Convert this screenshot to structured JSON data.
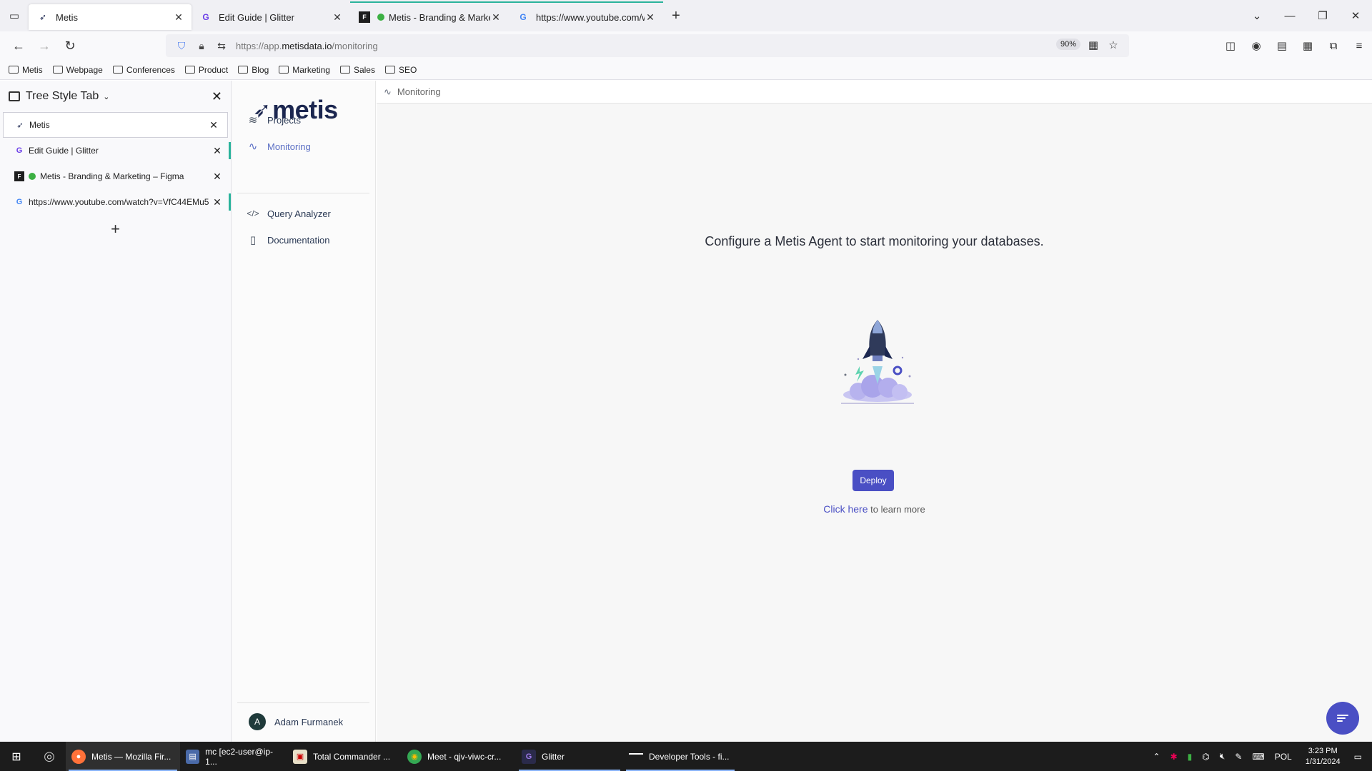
{
  "browser": {
    "tabs": [
      {
        "title": "Metis",
        "icon": "metis-favicon",
        "active": true
      },
      {
        "title": "Edit Guide | Glitter",
        "icon": "glitter-favicon"
      },
      {
        "title": "Metis - Branding & Marketing",
        "icon": "figma-favicon"
      },
      {
        "title": "https://www.youtube.com/wat",
        "icon": "google-favicon"
      }
    ],
    "url_prefix": "https://app.",
    "url_domain": "metisdata.io",
    "url_path": "/monitoring",
    "zoom": "90%",
    "bookmarks": [
      "Metis",
      "Webpage",
      "Conferences",
      "Product",
      "Blog",
      "Marketing",
      "Sales",
      "SEO"
    ]
  },
  "tst": {
    "title": "Tree Style Tab",
    "tabs": [
      {
        "title": "Metis"
      },
      {
        "title": "Edit Guide | Glitter"
      },
      {
        "title": "Metis - Branding & Marketing – Figma"
      },
      {
        "title": "https://www.youtube.com/watch?v=VfC44EMu5"
      }
    ]
  },
  "app": {
    "logo": "metis",
    "nav": {
      "projects": "Projects",
      "monitoring": "Monitoring",
      "query_analyzer": "Query Analyzer",
      "documentation": "Documentation"
    },
    "user_initial": "A",
    "user_name": "Adam Furmanek"
  },
  "main": {
    "breadcrumb": "Monitoring",
    "headline": "Configure a Metis Agent to start monitoring your databases.",
    "deploy_label": "Deploy",
    "learn_link": "Click here",
    "learn_suffix": " to learn more"
  },
  "taskbar": {
    "items": [
      {
        "label": "Metis — Mozilla Fir...",
        "icon": "firefox-icon",
        "active": true
      },
      {
        "label": "mc [ec2-user@ip-1...",
        "icon": "terminal-icon"
      },
      {
        "label": "Total Commander ...",
        "icon": "total-commander-icon"
      },
      {
        "label": "Meet - qjv-viwc-cr...",
        "icon": "chrome-icon"
      },
      {
        "label": "Glitter",
        "icon": "glitter-icon"
      },
      {
        "label": "Developer Tools - fi...",
        "icon": "devtools-icon"
      }
    ],
    "lang": "POL",
    "time": "3:23 PM",
    "date": "1/31/2024"
  },
  "colors": {
    "accent": "#4a4fc4",
    "active_nav": "#5b6fc4",
    "tab_highlight": "#2ab39b"
  }
}
